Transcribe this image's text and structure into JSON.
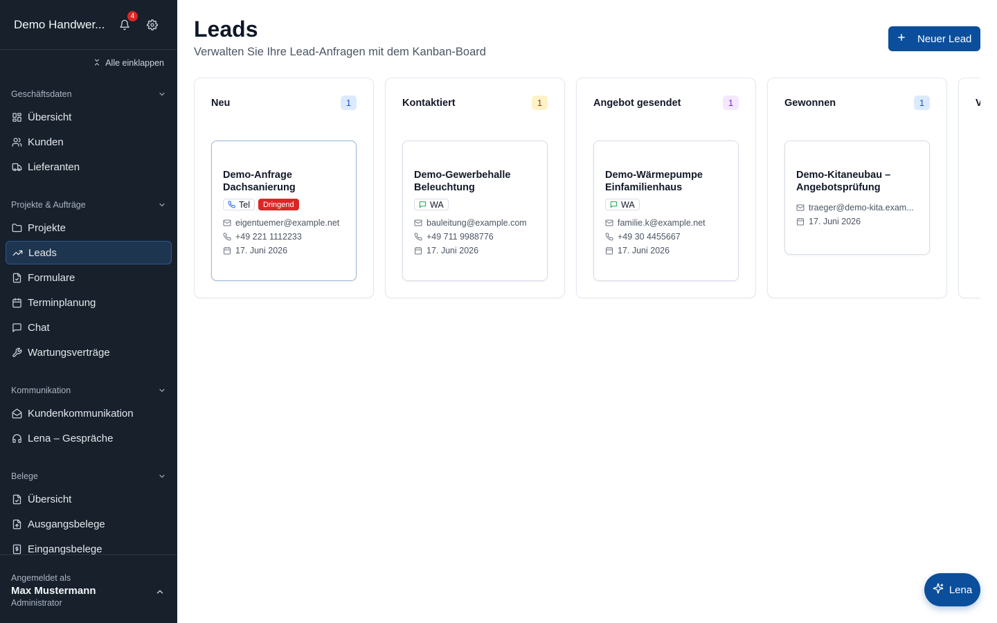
{
  "sidebar": {
    "app_name": "Demo Handwer...",
    "notification_count": "4",
    "collapse_all": "Alle einklappen",
    "sections": [
      {
        "label": "Geschäftsdaten",
        "items": [
          "Übersicht",
          "Kunden",
          "Lieferanten"
        ]
      },
      {
        "label": "Projekte & Aufträge",
        "items": [
          "Projekte",
          "Leads",
          "Formulare",
          "Terminplanung",
          "Chat",
          "Wartungsverträge"
        ]
      },
      {
        "label": "Kommunikation",
        "items": [
          "Kundenkommunikation",
          "Lena – Gespräche"
        ]
      },
      {
        "label": "Belege",
        "items": [
          "Übersicht",
          "Ausgangsbelege",
          "Eingangsbelege"
        ]
      }
    ],
    "active_item": "Leads",
    "footer": {
      "label": "Angemeldet als",
      "user": "Max Mustermann",
      "role": "Administrator"
    }
  },
  "main": {
    "title": "Leads",
    "subtitle": "Verwalten Sie Ihre Lead-Anfragen mit dem Kanban-Board",
    "new_button": "Neuer Lead",
    "columns": [
      {
        "title": "Neu",
        "count": "1",
        "card": {
          "title": "Demo-Anfrage Dachsanierung",
          "tags": [
            {
              "label": "Tel",
              "icon": "phone-icon"
            },
            {
              "label": "Dringend",
              "type": "urgent"
            }
          ],
          "email": "eigentuemer@example.net",
          "phone": "+49 221 1112233",
          "date": "17. Juni 2026"
        }
      },
      {
        "title": "Kontaktiert",
        "count": "1",
        "card": {
          "title": "Demo-Gewerbehalle Beleuchtung",
          "tags": [
            {
              "label": "WA",
              "icon": "chat-icon"
            }
          ],
          "email": "bauleitung@example.com",
          "phone": "+49 711 9988776",
          "date": "17. Juni 2026"
        }
      },
      {
        "title": "Angebot gesendet",
        "count": "1",
        "card": {
          "title": "Demo-Wärmepumpe Einfamilienhaus",
          "tags": [
            {
              "label": "WA",
              "icon": "chat-icon"
            }
          ],
          "email": "familie.k@example.net",
          "phone": "+49 30 4455667",
          "date": "17. Juni 2026"
        }
      },
      {
        "title": "Gewonnen",
        "count": "1",
        "card": {
          "title": "Demo-Kitaneubau – Angebotsprüfung",
          "tags": [],
          "email": "traeger@demo-kita.exam...",
          "date": "17. Juni 2026"
        }
      },
      {
        "title": "V",
        "count": ""
      }
    ]
  },
  "fab_label": "Lena",
  "colors": {
    "sidebar_bg": "#17202b",
    "primary": "#0b4f9c",
    "urgent": "#dc2626",
    "count_neu": "#dbeafe",
    "count_kontaktiert": "#fef3c7",
    "count_angebot": "#f3e8ff",
    "count_gewonnen": "#dbeafe"
  }
}
